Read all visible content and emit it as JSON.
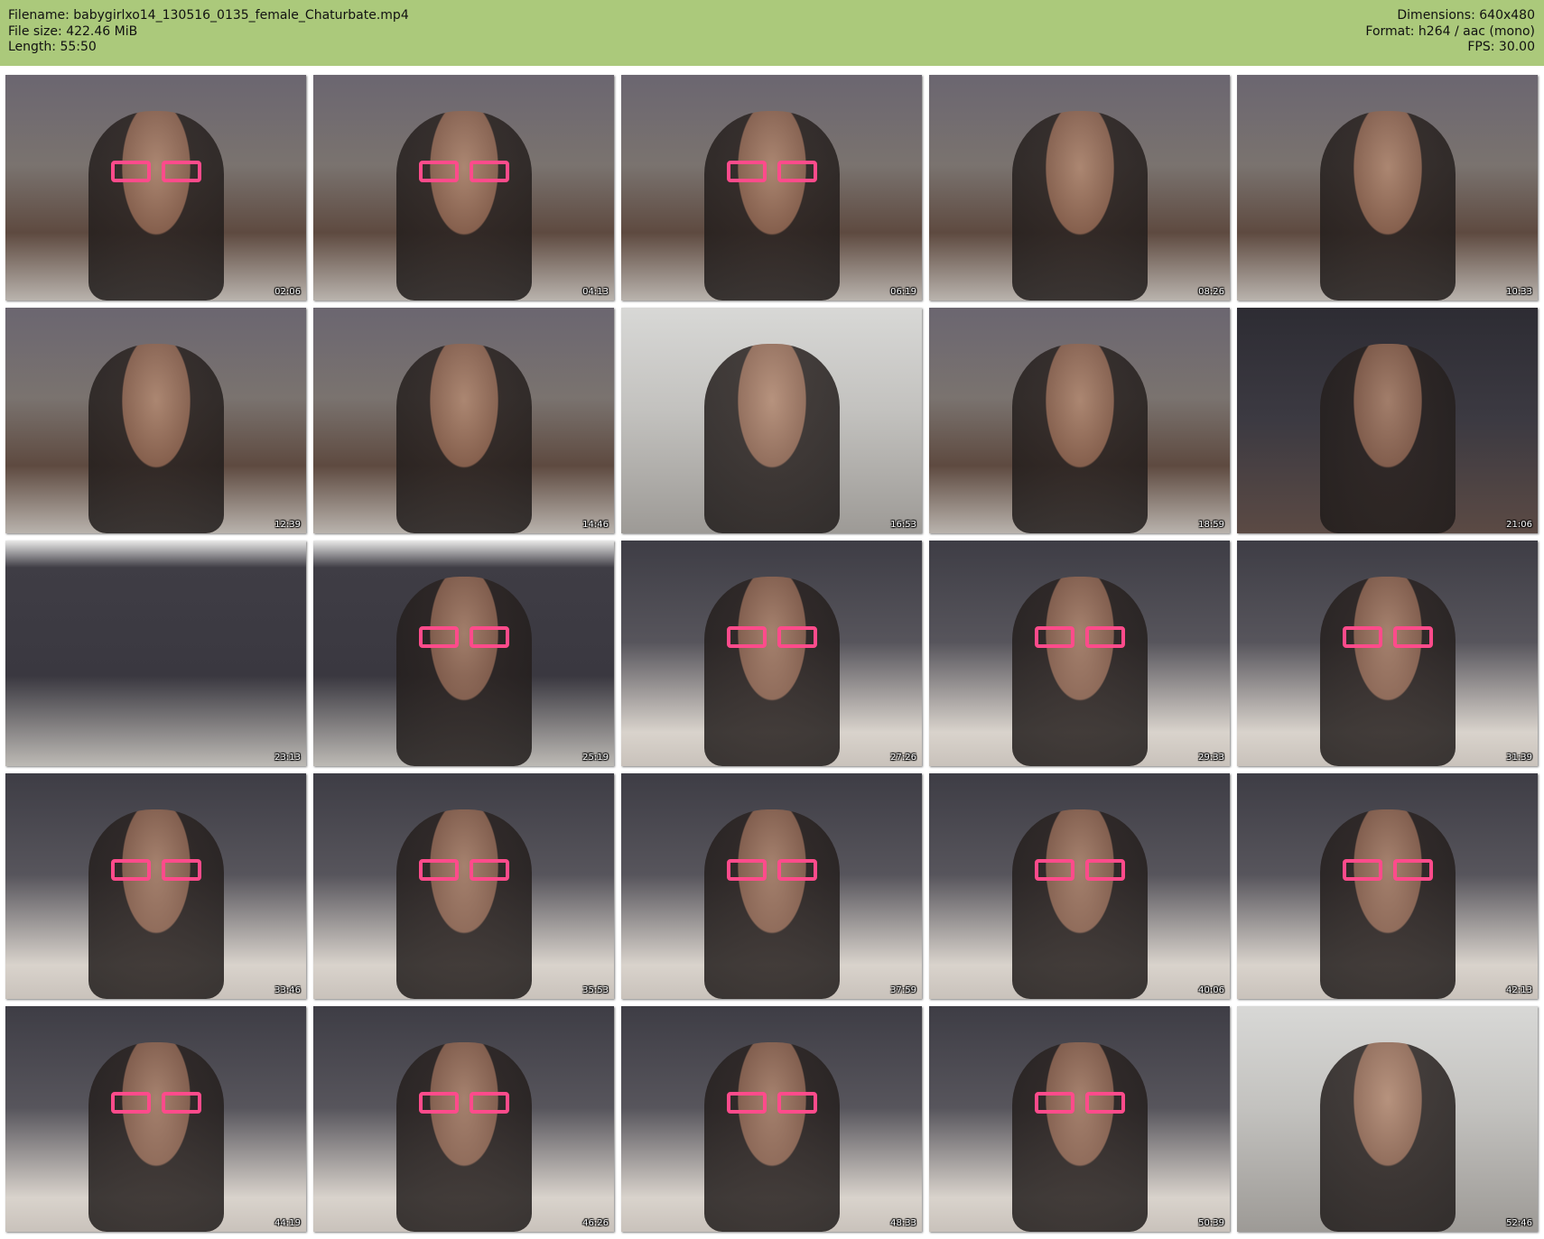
{
  "header": {
    "filename_label": "Filename: babygirlxo14_130516_0135_female_Chaturbate.mp4",
    "filesize_label": "File size: 422.46 MiB",
    "length_label": "Length: 55:50",
    "dimensions_label": "Dimensions: 640x480",
    "format_label": "Format: h264 / aac (mono)",
    "fps_label": "FPS: 30.00",
    "background_color": "#abc97b"
  },
  "thumbnails": [
    {
      "timestamp": "02:06"
    },
    {
      "timestamp": "04:13"
    },
    {
      "timestamp": "06:19"
    },
    {
      "timestamp": "08:26"
    },
    {
      "timestamp": "10:33"
    },
    {
      "timestamp": "12:39"
    },
    {
      "timestamp": "14:46"
    },
    {
      "timestamp": "16:53"
    },
    {
      "timestamp": "18:59"
    },
    {
      "timestamp": "21:06"
    },
    {
      "timestamp": "23:13"
    },
    {
      "timestamp": "25:19"
    },
    {
      "timestamp": "27:26"
    },
    {
      "timestamp": "29:33"
    },
    {
      "timestamp": "31:39"
    },
    {
      "timestamp": "33:46"
    },
    {
      "timestamp": "35:53"
    },
    {
      "timestamp": "37:59"
    },
    {
      "timestamp": "40:06"
    },
    {
      "timestamp": "42:13"
    },
    {
      "timestamp": "44:19"
    },
    {
      "timestamp": "46:26"
    },
    {
      "timestamp": "48:33"
    },
    {
      "timestamp": "50:39"
    },
    {
      "timestamp": "52:46"
    }
  ]
}
